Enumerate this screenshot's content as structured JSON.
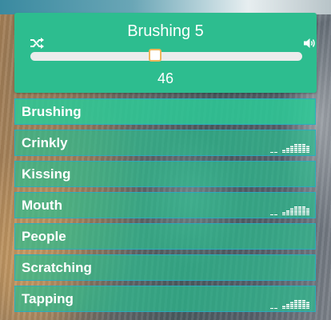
{
  "player": {
    "title": "Brushing 5",
    "value": "46",
    "slider_fraction": 0.46,
    "accent_color": "#2dbd8f",
    "thumb_border_color": "#f0b55a",
    "icons": {
      "left": "shuffle-icon",
      "right": "volume-icon"
    }
  },
  "sounds": [
    {
      "label": "Brushing",
      "active": true,
      "eq": false
    },
    {
      "label": "Crinkly",
      "active": false,
      "eq": true
    },
    {
      "label": "Kissing",
      "active": false,
      "eq": false
    },
    {
      "label": "Mouth",
      "active": false,
      "eq": true
    },
    {
      "label": "People",
      "active": false,
      "eq": false
    },
    {
      "label": "Scratching",
      "active": false,
      "eq": false
    },
    {
      "label": "Tapping",
      "active": false,
      "eq": true
    }
  ]
}
